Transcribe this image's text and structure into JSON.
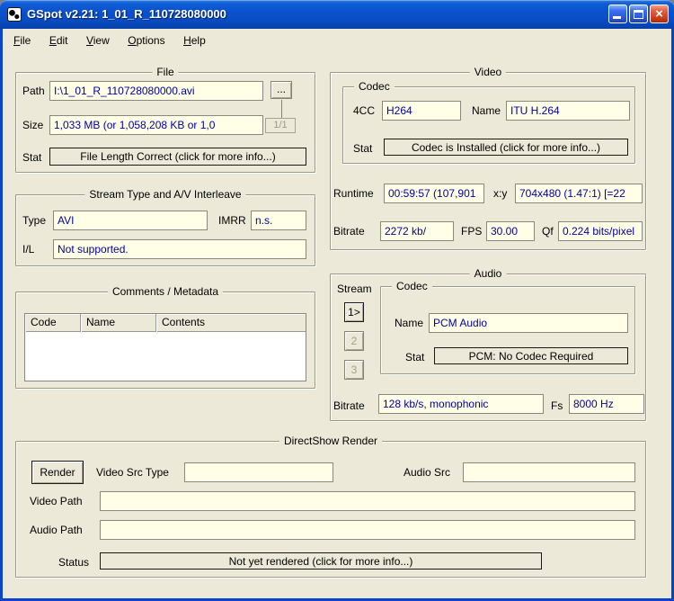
{
  "titlebar": {
    "title": "GSpot v2.21: 1_01_R_110728080000",
    "close_glyph": "×"
  },
  "menu": {
    "items": [
      "File",
      "Edit",
      "View",
      "Options",
      "Help"
    ]
  },
  "file_group": {
    "title": "File",
    "path_label": "Path",
    "path_value": "I:\\1_01_R_110728080000.avi",
    "browse_label": "...",
    "size_label": "Size",
    "size_value": "1,033 MB (or 1,058,208 KB or 1,0",
    "page_value": "1/1",
    "stat_label": "Stat",
    "stat_value": "File Length Correct (click for more info...)"
  },
  "stream_group": {
    "title": "Stream Type and A/V Interleave",
    "type_label": "Type",
    "type_value": "AVI",
    "imrr_label": "IMRR",
    "imrr_value": "n.s.",
    "il_label": "I/L",
    "il_value": "Not supported."
  },
  "comments_group": {
    "title": "Comments / Metadata",
    "columns": [
      "Code",
      "Name",
      "Contents"
    ],
    "rows": []
  },
  "video_group": {
    "title": "Video",
    "codec": {
      "title": "Codec",
      "fourcc_label": "4CC",
      "fourcc_value": "H264",
      "name_label": "Name",
      "name_value": "ITU H.264",
      "stat_label": "Stat",
      "stat_value": "Codec is Installed (click for more info...)"
    },
    "runtime_label": "Runtime",
    "runtime_value": "00:59:57 (107,901",
    "xy_label": "x:y",
    "xy_value": "704x480 (1.47:1) [=22",
    "bitrate_label": "Bitrate",
    "bitrate_value": "2272 kb/",
    "fps_label": "FPS",
    "fps_value": "30.00",
    "qf_label": "Qf",
    "qf_value": "0.224 bits/pixel"
  },
  "audio_group": {
    "title": "Audio",
    "stream_label": "Stream",
    "stream_buttons": [
      "1>",
      "2",
      "3"
    ],
    "codec": {
      "title": "Codec",
      "name_label": "Name",
      "name_value": "PCM Audio",
      "stat_label": "Stat",
      "stat_value": "PCM: No Codec Required"
    },
    "bitrate_label": "Bitrate",
    "bitrate_value": "128 kb/s, monophonic",
    "fs_label": "Fs",
    "fs_value": "8000 Hz"
  },
  "render_group": {
    "title": "DirectShow Render",
    "render_button": "Render",
    "video_src_label": "Video Src Type",
    "video_src_value": "",
    "audio_src_label": "Audio Src",
    "audio_src_value": "",
    "video_path_label": "Video Path",
    "video_path_value": "",
    "audio_path_label": "Audio Path",
    "audio_path_value": "",
    "status_label": "Status",
    "status_value": "Not yet rendered (click for more info...)"
  },
  "colors": {
    "field_bg": "#FFFFE8",
    "value_text": "#0000A0",
    "titlebar_blue": "#0A50CC",
    "window_bg": "#ECE9D8"
  }
}
